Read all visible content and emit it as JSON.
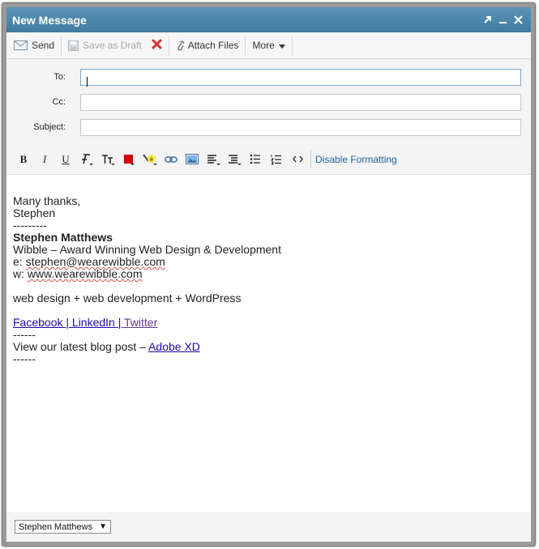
{
  "window": {
    "title": "New Message"
  },
  "toolbar": {
    "send_label": "Send",
    "draft_label": "Save as Draft",
    "attach_label": "Attach Files",
    "more_label": "More"
  },
  "fields": {
    "to_label": "To:",
    "cc_label": "Cc:",
    "subject_label": "Subject:",
    "to_value": "",
    "cc_value": "",
    "subject_value": ""
  },
  "format": {
    "bold": "B",
    "italic": "I",
    "underline": "U",
    "disable_label": "Disable Formatting"
  },
  "signature": {
    "thanks": "Many thanks,",
    "first_name": "Stephen",
    "rule1": "---------",
    "name": "Stephen Matthews",
    "company": "Wibble – Award Winning Web Design & Development",
    "email_prefix": "e: ",
    "email": "stephen@wearewibble.com",
    "web_prefix": "w: ",
    "web": "www.wearewibble.com",
    "tagline": "web design + web development + WordPress",
    "facebook": "Facebook ",
    "sep1": "|",
    "linkedin": " LinkedIn ",
    "sep2": "|",
    "twitter": " Twitter",
    "rule2": "------",
    "blog_prefix": "View our latest blog post – ",
    "blog_link": "Adobe XD",
    "rule3": "------"
  },
  "footer": {
    "from_value": "Stephen Matthews"
  },
  "colors": {
    "titlebar": "#4a86aa",
    "link": "#1a0dab",
    "accent": "#1f5f9e"
  }
}
